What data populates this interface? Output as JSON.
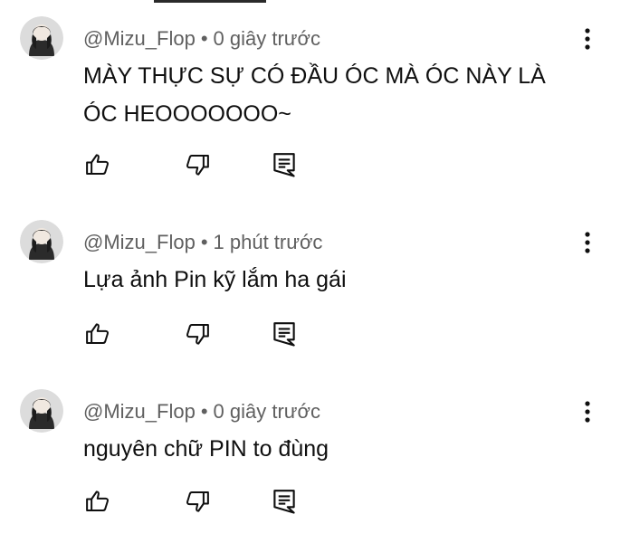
{
  "colors": {
    "text_primary": "#0f0f0f",
    "text_secondary": "#606060",
    "icon": "#0f0f0f"
  },
  "comments": [
    {
      "author": "@Mizu_Flop",
      "separator": "•",
      "time": "0 giây trước",
      "text": "MÀY THỰC SỰ CÓ ĐẦU ÓC MÀ ÓC NÀY LÀ ÓC HEOOOOOOO~",
      "avatar_icon": "profile-avatar",
      "menu_icon": "more-vert-icon",
      "like_icon": "thumb-up-icon",
      "dislike_icon": "thumb-down-icon",
      "reply_icon": "reply-icon"
    },
    {
      "author": "@Mizu_Flop",
      "separator": "•",
      "time": "1 phút trước",
      "text": "Lựa ảnh Pin kỹ lắm ha gái",
      "avatar_icon": "profile-avatar",
      "menu_icon": "more-vert-icon",
      "like_icon": "thumb-up-icon",
      "dislike_icon": "thumb-down-icon",
      "reply_icon": "reply-icon"
    },
    {
      "author": "@Mizu_Flop",
      "separator": "•",
      "time": "0 giây trước",
      "text": "nguyên chữ PIN to đùng",
      "avatar_icon": "profile-avatar",
      "menu_icon": "more-vert-icon",
      "like_icon": "thumb-up-icon",
      "dislike_icon": "thumb-down-icon",
      "reply_icon": "reply-icon"
    }
  ]
}
